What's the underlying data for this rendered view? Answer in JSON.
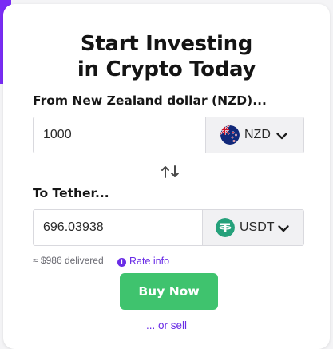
{
  "heading": {
    "line1": "Start Investing",
    "line2": "in Crypto Today"
  },
  "from": {
    "label": "From New Zealand dollar (NZD)...",
    "amount": "1000",
    "currency_code": "NZD",
    "currency_icon": "new-zealand-flag-icon"
  },
  "to": {
    "label": "To Tether...",
    "amount": "696.03938",
    "currency_code": "USDT",
    "currency_icon": "tether-logo-icon",
    "currency_icon_color": "#26a17b"
  },
  "swap_icon": "swap-arrows-icon",
  "delivered_text": "≈ $986 delivered",
  "rate_info": {
    "icon": "info-icon",
    "icon_glyph": "i",
    "label": "Rate info"
  },
  "buy_button": {
    "label": "Buy Now",
    "color": "#3fc36e"
  },
  "sell_link": "... or sell",
  "colors": {
    "accent": "#7a2cf5",
    "link": "#6a2de6"
  }
}
